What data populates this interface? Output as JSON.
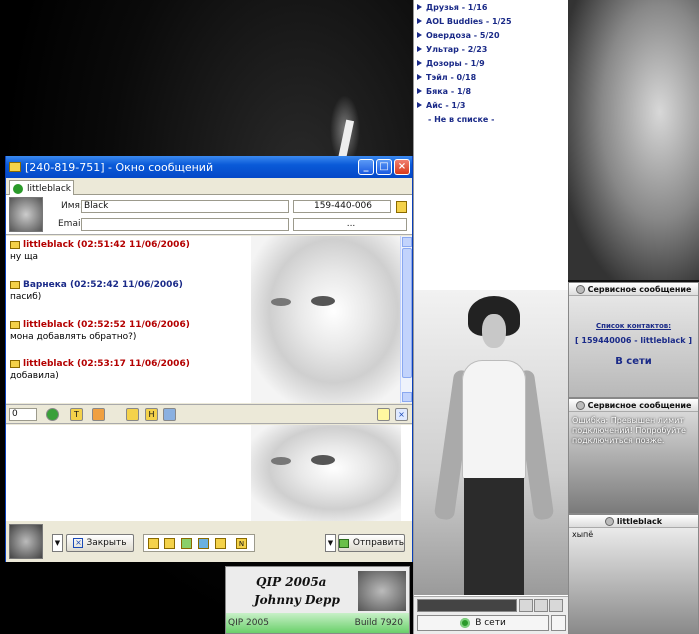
{
  "contact_list": {
    "groups": [
      "Друзья - 1/16",
      "AOL Buddies - 1/25",
      "Овердоза - 5/20",
      "Ультар - 2/23",
      "Дозоры - 1/9",
      "Тэйл - 0/18",
      "Бяка - 1/8",
      "Айс - 1/3",
      "- Не в списке -"
    ],
    "status_label": "В сети"
  },
  "popups": {
    "service_title": "Сервисное сообщение",
    "p1_label": "Список контактов:",
    "p1_value": "[ 159440006 - littleblack ]",
    "p1_status": "В сети",
    "p2_text": "Ошибка: Превышен лимит подключений! Попробуйте подключиться позже.",
    "p3_title": "littleblack",
    "p3_text": "хыпё"
  },
  "banner": {
    "line1": "QIP 2005a",
    "line2": "Johnny Depp",
    "left": "QIP 2005",
    "right": "Build 7920"
  },
  "window": {
    "title": "[240-819-751] - Окно сообщений",
    "tab": "littleblack",
    "name_label": "Имя:",
    "name_value": "Black",
    "uin_value": "159-440-006",
    "email_label": "Email:",
    "dots": "...",
    "messages": [
      {
        "who": "littleblack (02:51:42 11/06/2006)",
        "text": "ну ща",
        "color": "#b40000"
      },
      {
        "who": "Варнека (02:52:42 11/06/2006)",
        "text": "пасиб)",
        "color": "#1a2a88"
      },
      {
        "who": "littleblack (02:52:52 11/06/2006)",
        "text": "мона добавлять обратно?)",
        "color": "#b40000"
      },
      {
        "who": "littleblack (02:53:17 11/06/2006)",
        "text": "добавила)",
        "color": "#b40000"
      }
    ],
    "counter": "0",
    "close_label": "Закрыть",
    "send_label": "Отправить"
  }
}
